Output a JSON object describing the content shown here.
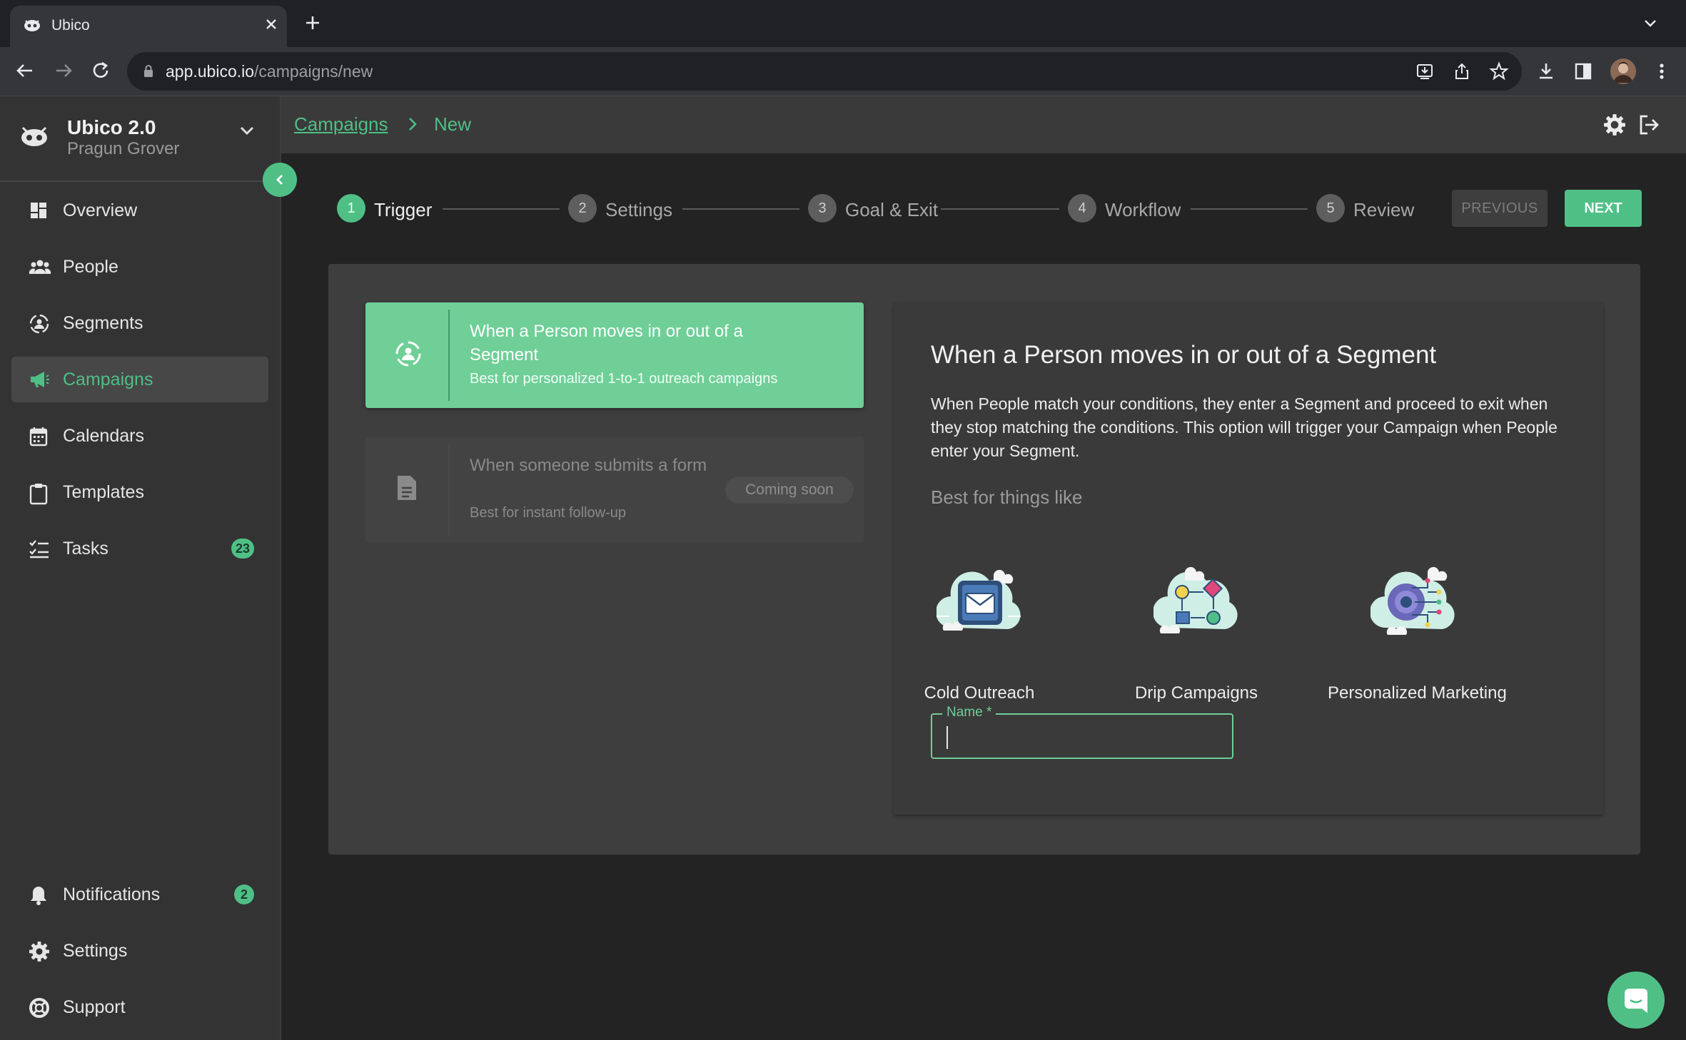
{
  "browser": {
    "tab_title": "Ubico",
    "url_domain": "app.ubico.io",
    "url_path": "/campaigns/new"
  },
  "sidebar": {
    "app_name": "Ubico 2.0",
    "user_name": "Pragun Grover",
    "items": [
      {
        "label": "Overview",
        "icon": "overview-icon"
      },
      {
        "label": "People",
        "icon": "people-icon"
      },
      {
        "label": "Segments",
        "icon": "segments-icon"
      },
      {
        "label": "Campaigns",
        "icon": "megaphone-icon",
        "active": true
      },
      {
        "label": "Calendars",
        "icon": "calendar-icon"
      },
      {
        "label": "Templates",
        "icon": "clipboard-icon"
      },
      {
        "label": "Tasks",
        "icon": "tasks-icon",
        "badge": "23"
      }
    ],
    "bottom_items": [
      {
        "label": "Notifications",
        "icon": "bell-icon",
        "badge": "2"
      },
      {
        "label": "Settings",
        "icon": "gear-icon"
      },
      {
        "label": "Support",
        "icon": "lifebuoy-icon"
      }
    ]
  },
  "breadcrumb": {
    "parent": "Campaigns",
    "current": "New"
  },
  "stepper": {
    "steps": [
      {
        "num": "1",
        "label": "Trigger",
        "active": true
      },
      {
        "num": "2",
        "label": "Settings"
      },
      {
        "num": "3",
        "label": "Goal & Exit"
      },
      {
        "num": "4",
        "label": "Workflow"
      },
      {
        "num": "5",
        "label": "Review"
      }
    ],
    "previous_label": "PREVIOUS",
    "next_label": "NEXT"
  },
  "trigger_options": [
    {
      "title": "When a Person moves in or out of a Segment",
      "subtitle": "Best for personalized 1-to-1 outreach campaigns",
      "selected": true
    },
    {
      "title": "When someone submits a form",
      "subtitle": "Best for instant follow-up",
      "badge": "Coming soon",
      "disabled": true
    }
  ],
  "detail": {
    "title": "When a Person moves in or out of a Segment",
    "body": "When People match your conditions, they enter a Segment and proceed to exit when they stop matching the conditions. This option will trigger your Campaign when People enter your Segment.",
    "best_for_label": "Best for things like",
    "examples": [
      "Cold Outreach",
      "Drip Campaigns",
      "Personalized Marketing"
    ],
    "name_label": "Name *",
    "name_value": ""
  },
  "colors": {
    "accent": "#4fbf86",
    "selected_card": "#6fcf97",
    "background": "#232323",
    "sidebar": "#333333"
  }
}
